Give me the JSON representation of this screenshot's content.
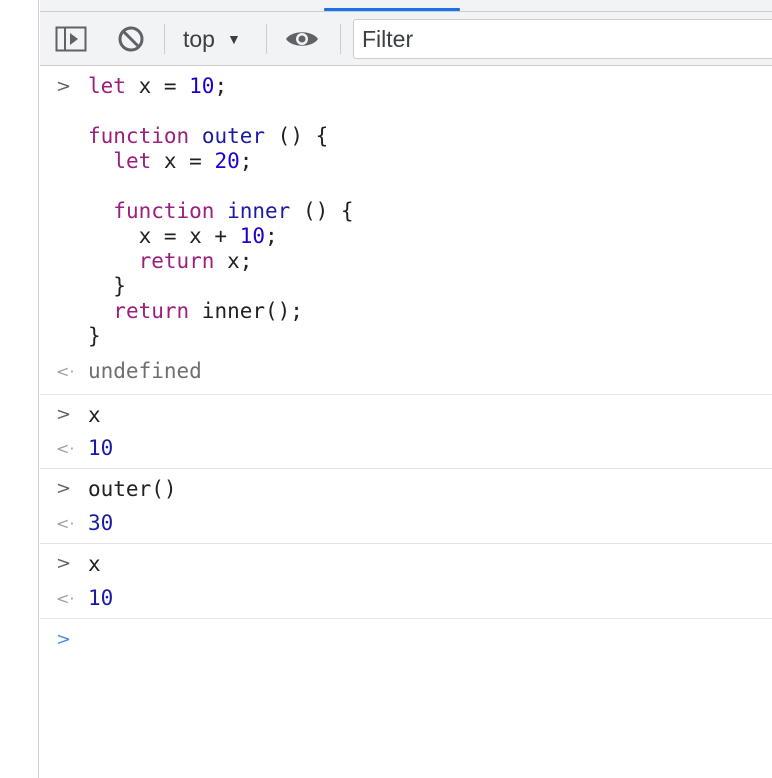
{
  "toolbar": {
    "context_label": "top",
    "filter_placeholder": "Filter",
    "icons": [
      "sidebar-toggle-icon",
      "clear-console-icon",
      "context-caret-icon",
      "eye-icon"
    ]
  },
  "colors": {
    "keyword": "#9c1e7e",
    "identifier": "#1a1aa6",
    "number": "#1c00cf",
    "undefined": "#6e6e73",
    "prompt": "#4a8af4",
    "tab_indicator": "#1a73e8"
  },
  "console": {
    "block": {
      "l1": {
        "kw": "let",
        "rest1": " x = ",
        "num": "10",
        "rest2": ";"
      },
      "l3": {
        "kw": "function",
        "fn": "outer",
        "rest": " () {"
      },
      "l4": {
        "kw": "let",
        "rest1": " x = ",
        "num": "20",
        "rest2": ";"
      },
      "l6": {
        "kw": "function",
        "fn": "inner",
        "rest": " () {"
      },
      "l7": {
        "rest1": "x = x + ",
        "num": "10",
        "rest2": ";"
      },
      "l8": {
        "kw": "return",
        "rest": " x;"
      },
      "l9": "}",
      "l10": {
        "kw": "return",
        "rest": " inner();"
      },
      "l11": "}"
    },
    "result1": "undefined",
    "input2": "x",
    "result2": "10",
    "input3": "outer()",
    "result3": "30",
    "input4": "x",
    "result4": "10"
  }
}
